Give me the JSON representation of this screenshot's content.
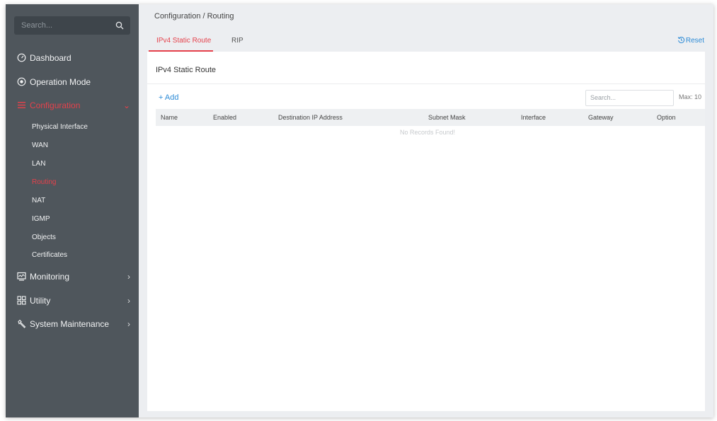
{
  "sidebar": {
    "search_placeholder": "Search...",
    "items": [
      {
        "label": "Dashboard"
      },
      {
        "label": "Operation Mode"
      },
      {
        "label": "Configuration",
        "chevron": "⌄"
      },
      {
        "label": "Monitoring",
        "chevron": "›"
      },
      {
        "label": "Utility",
        "chevron": "›"
      },
      {
        "label": "System Maintenance",
        "chevron": "›"
      }
    ],
    "subitems": [
      "Physical Interface",
      "WAN",
      "LAN",
      "Routing",
      "NAT",
      "IGMP",
      "Objects",
      "Certificates"
    ]
  },
  "header": {
    "breadcrumb": "Configuration / Routing",
    "tabs": [
      {
        "label": "IPv4 Static Route"
      },
      {
        "label": "RIP"
      }
    ],
    "reset_label": "Reset"
  },
  "main": {
    "card_title": "IPv4 Static Route",
    "add_label": "+ Add",
    "search_placeholder": "Search...",
    "max_label": "Max: 10",
    "columns": [
      "Name",
      "Enabled",
      "Destination IP Address",
      "Subnet Mask",
      "Interface",
      "Gateway",
      "Option"
    ],
    "empty_text": "No Records Found!"
  },
  "colors": {
    "accent": "#e5414b",
    "link": "#2d8bd6",
    "sidebar_bg": "#4f565c"
  }
}
